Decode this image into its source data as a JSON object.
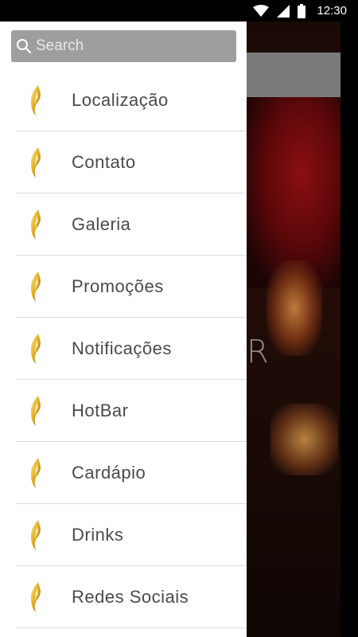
{
  "status_bar": {
    "time": "12:30",
    "icons": [
      "wifi-icon",
      "signal-icon",
      "battery-icon"
    ]
  },
  "search": {
    "placeholder": "Search"
  },
  "menu": {
    "items": [
      {
        "label": "Localização",
        "icon": "gold-flame-icon"
      },
      {
        "label": "Contato",
        "icon": "gold-flame-icon"
      },
      {
        "label": "Galeria",
        "icon": "gold-flame-icon"
      },
      {
        "label": "Promoções",
        "icon": "gold-flame-icon"
      },
      {
        "label": "Notificações",
        "icon": "gold-flame-icon"
      },
      {
        "label": "HotBar",
        "icon": "gold-flame-icon"
      },
      {
        "label": "Cardápio",
        "icon": "gold-flame-icon"
      },
      {
        "label": "Drinks",
        "icon": "gold-flame-icon"
      },
      {
        "label": "Redes  Sociais",
        "icon": "gold-flame-icon"
      }
    ]
  },
  "background": {
    "partial_letter": "R"
  },
  "colors": {
    "drawer_bg": "#ffffff",
    "search_bg": "#9e9e9e",
    "label_text": "#4a4a4a",
    "divider": "#dcdcdc",
    "icon_gold": "#d4a017"
  }
}
